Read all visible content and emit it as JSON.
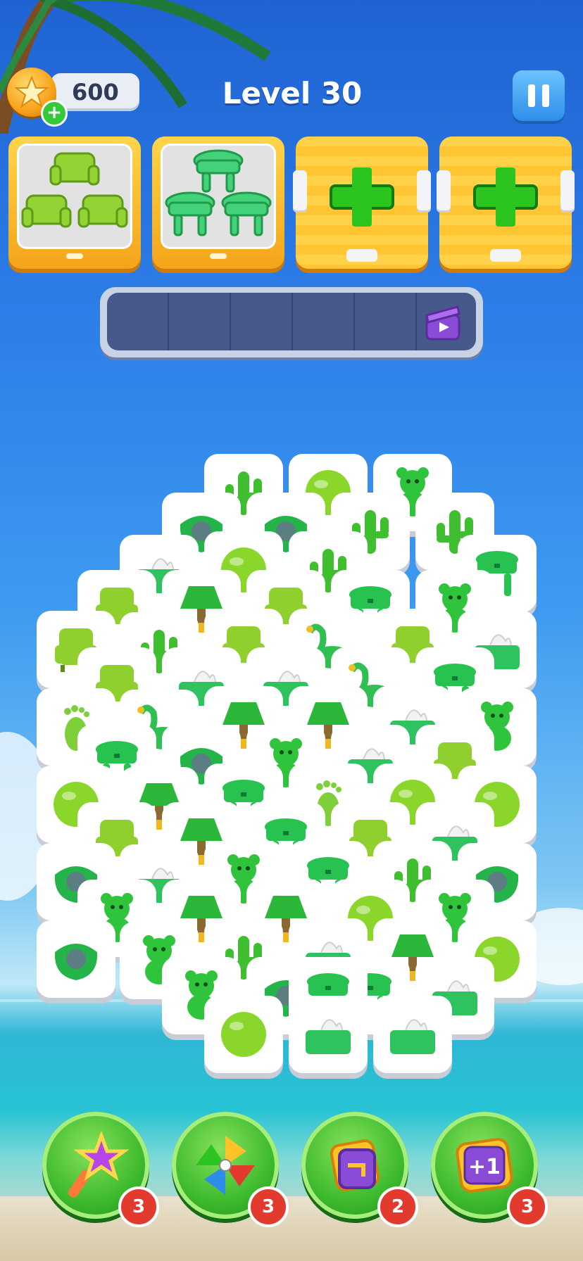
{
  "header": {
    "coins": "600",
    "level_title": "Level 30"
  },
  "goal_slots": [
    {
      "item": "armchair",
      "type": "filled"
    },
    {
      "item": "stool",
      "type": "filled"
    },
    {
      "item": "add-slot",
      "type": "locked"
    },
    {
      "item": "add-slot",
      "type": "locked"
    }
  ],
  "tray": {
    "cell_count": 6,
    "extra_icon": "video-ad-icon"
  },
  "tile_types": {
    "bear": "#2fc43b",
    "ring": "#24b44a",
    "flamingo": "#2fbf52",
    "lamp": "#2bb83a",
    "tissue": "#2fc360",
    "cactus": "#3fbf2f",
    "ball": "#8ad62b",
    "chair": "#8fd02e",
    "foot": "#7fcf3b",
    "stool": "#27c24f"
  },
  "tiles": [
    [
      "chair",
      0
    ],
    [
      "foot",
      0
    ],
    [
      "ball",
      0
    ],
    [
      "ring",
      0
    ],
    [
      "ring",
      0
    ],
    [
      "chair",
      0
    ],
    [
      "chair",
      0
    ],
    [
      "stool",
      0
    ],
    [
      "chair",
      0
    ],
    [
      "bear",
      0
    ],
    [
      "tissue",
      0
    ],
    [
      "cactus",
      0
    ],
    [
      "flamingo",
      0
    ],
    [
      "lamp",
      0
    ],
    [
      "tissue",
      0
    ],
    [
      "bear",
      0
    ],
    [
      "ring",
      0
    ],
    [
      "lamp",
      0
    ],
    [
      "tissue",
      0
    ],
    [
      "ring",
      0
    ],
    [
      "lamp",
      0
    ],
    [
      "lamp",
      0
    ],
    [
      "bear",
      0
    ],
    [
      "cactus",
      0
    ],
    [
      "ball",
      0
    ],
    [
      "chair",
      0
    ],
    [
      "lamp",
      0
    ],
    [
      "stool",
      0
    ],
    [
      "bear",
      0
    ],
    [
      "cactus",
      0
    ],
    [
      "ball",
      0
    ],
    [
      "ring",
      0
    ],
    [
      "chair",
      0
    ],
    [
      "tissue",
      0
    ],
    [
      "bear",
      0
    ],
    [
      "stool",
      0
    ],
    [
      "lamp",
      0
    ],
    [
      "ring",
      0
    ],
    [
      "ball",
      0
    ],
    [
      "cactus",
      0
    ],
    [
      "flamingo",
      0
    ],
    [
      "lamp",
      0
    ],
    [
      "foot",
      0
    ],
    [
      "stool",
      0
    ],
    [
      "tissue",
      0
    ],
    [
      "tissue",
      0
    ],
    [
      "cactus",
      0
    ],
    [
      "stool",
      0
    ],
    [
      "flamingo",
      0
    ],
    [
      "tissue",
      0
    ],
    [
      "chair",
      0
    ],
    [
      "ball",
      0
    ],
    [
      "stool",
      0
    ],
    [
      "bear",
      0
    ],
    [
      "chair",
      0
    ],
    [
      "tissue",
      0
    ],
    [
      "ball",
      0
    ],
    [
      "cactus",
      0
    ],
    [
      "lamp",
      0
    ],
    [
      "tissue",
      0
    ],
    [
      "bear",
      0
    ],
    [
      "stool",
      0
    ],
    [
      "chair",
      0
    ],
    [
      "tissue",
      0
    ],
    [
      "bear",
      0
    ],
    [
      "stool",
      0
    ],
    [
      "tissue",
      0
    ],
    [
      "bear",
      0
    ],
    [
      "ball",
      0
    ],
    [
      "ring",
      0
    ],
    [
      "ball",
      0
    ],
    [
      "cactus",
      0
    ],
    [
      "tissue",
      0
    ],
    [
      "stool",
      0
    ]
  ],
  "boosters": [
    {
      "name": "magic-wand-booster",
      "count": "3"
    },
    {
      "name": "shuffle-pinwheel-booster",
      "count": "3"
    },
    {
      "name": "undo-booster",
      "count": "2"
    },
    {
      "name": "plus-one-booster",
      "count": "3"
    }
  ]
}
